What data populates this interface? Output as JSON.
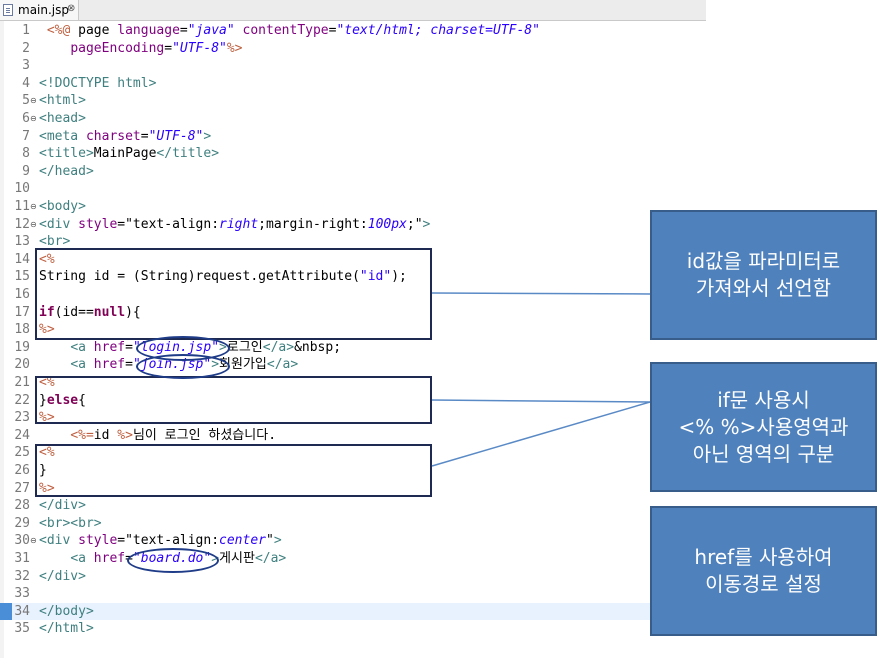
{
  "tab": {
    "label": "main.jsp",
    "close_symbol": "⊗"
  },
  "current_line": 34,
  "fold_symbol": "⊖",
  "lines": [
    {
      "n": "1",
      "fold": false,
      "parts": [
        {
          "c": "j",
          "t": " <%@"
        },
        {
          "c": "",
          "t": " page "
        },
        {
          "c": "a",
          "t": "language"
        },
        {
          "c": "",
          "t": "="
        },
        {
          "c": "s",
          "t": "\"java\""
        },
        {
          "c": "",
          "t": " "
        },
        {
          "c": "a",
          "t": "contentType"
        },
        {
          "c": "",
          "t": "="
        },
        {
          "c": "s",
          "t": "\"text/html; charset=UTF-8\""
        }
      ]
    },
    {
      "n": "2",
      "fold": false,
      "parts": [
        {
          "c": "",
          "t": "    "
        },
        {
          "c": "a",
          "t": "pageEncoding"
        },
        {
          "c": "",
          "t": "="
        },
        {
          "c": "s",
          "t": "\"UTF-8\""
        },
        {
          "c": "j",
          "t": "%>"
        }
      ]
    },
    {
      "n": "3",
      "fold": false,
      "parts": []
    },
    {
      "n": "4",
      "fold": false,
      "parts": [
        {
          "c": "t",
          "t": "<!DOCTYPE html>"
        }
      ]
    },
    {
      "n": "5",
      "fold": true,
      "parts": [
        {
          "c": "t",
          "t": "<html>"
        }
      ]
    },
    {
      "n": "6",
      "fold": true,
      "parts": [
        {
          "c": "t",
          "t": "<head>"
        }
      ]
    },
    {
      "n": "7",
      "fold": false,
      "parts": [
        {
          "c": "t",
          "t": "<meta "
        },
        {
          "c": "a",
          "t": "charset"
        },
        {
          "c": "",
          "t": "="
        },
        {
          "c": "s",
          "t": "\"UTF-8\""
        },
        {
          "c": "t",
          "t": ">"
        }
      ]
    },
    {
      "n": "8",
      "fold": false,
      "parts": [
        {
          "c": "t",
          "t": "<title>"
        },
        {
          "c": "",
          "t": "MainPage"
        },
        {
          "c": "t",
          "t": "</title>"
        }
      ]
    },
    {
      "n": "9",
      "fold": false,
      "parts": [
        {
          "c": "t",
          "t": "</head>"
        }
      ]
    },
    {
      "n": "10",
      "fold": false,
      "parts": []
    },
    {
      "n": "11",
      "fold": true,
      "parts": [
        {
          "c": "t",
          "t": "<body>"
        }
      ]
    },
    {
      "n": "12",
      "fold": true,
      "parts": [
        {
          "c": "t",
          "t": "<div "
        },
        {
          "c": "a",
          "t": "style"
        },
        {
          "c": "",
          "t": "=\"text-align:"
        },
        {
          "c": "s",
          "t": "right"
        },
        {
          "c": "",
          "t": ";margin-right:"
        },
        {
          "c": "s",
          "t": "100px"
        },
        {
          "c": "",
          "t": ";\""
        },
        {
          "c": "t",
          "t": ">"
        }
      ]
    },
    {
      "n": "13",
      "fold": false,
      "parts": [
        {
          "c": "t",
          "t": "<br>"
        }
      ]
    },
    {
      "n": "14",
      "fold": false,
      "parts": [
        {
          "c": "j",
          "t": "<%"
        }
      ]
    },
    {
      "n": "15",
      "fold": false,
      "parts": [
        {
          "c": "",
          "t": "String id = (String)request.getAttribute("
        },
        {
          "c": "sp",
          "t": "\"id\""
        },
        {
          "c": "",
          "t": ");"
        }
      ]
    },
    {
      "n": "16",
      "fold": false,
      "parts": []
    },
    {
      "n": "17",
      "fold": false,
      "parts": [
        {
          "c": "k",
          "t": "if"
        },
        {
          "c": "",
          "t": "(id=="
        },
        {
          "c": "k",
          "t": "null"
        },
        {
          "c": "",
          "t": "){"
        }
      ]
    },
    {
      "n": "18",
      "fold": false,
      "parts": [
        {
          "c": "j",
          "t": "%>"
        }
      ]
    },
    {
      "n": "19",
      "fold": false,
      "parts": [
        {
          "c": "",
          "t": "    "
        },
        {
          "c": "t",
          "t": "<a "
        },
        {
          "c": "a",
          "t": "href"
        },
        {
          "c": "",
          "t": "="
        },
        {
          "c": "s",
          "t": "\"login.jsp\""
        },
        {
          "c": "t",
          "t": ">"
        },
        {
          "c": "",
          "t": "로그인"
        },
        {
          "c": "t",
          "t": "</a>"
        },
        {
          "c": "",
          "t": "&nbsp;"
        }
      ]
    },
    {
      "n": "20",
      "fold": false,
      "parts": [
        {
          "c": "",
          "t": "    "
        },
        {
          "c": "t",
          "t": "<a "
        },
        {
          "c": "a",
          "t": "href"
        },
        {
          "c": "",
          "t": "="
        },
        {
          "c": "s",
          "t": "\"join.jsp\""
        },
        {
          "c": "t",
          "t": ">"
        },
        {
          "c": "",
          "t": "회원가입"
        },
        {
          "c": "t",
          "t": "</a>"
        }
      ]
    },
    {
      "n": "21",
      "fold": false,
      "parts": [
        {
          "c": "j",
          "t": "<%"
        }
      ]
    },
    {
      "n": "22",
      "fold": false,
      "parts": [
        {
          "c": "",
          "t": "}"
        },
        {
          "c": "k",
          "t": "else"
        },
        {
          "c": "",
          "t": "{"
        }
      ]
    },
    {
      "n": "23",
      "fold": false,
      "parts": [
        {
          "c": "j",
          "t": "%>"
        }
      ]
    },
    {
      "n": "24",
      "fold": false,
      "parts": [
        {
          "c": "",
          "t": "    "
        },
        {
          "c": "j",
          "t": "<%="
        },
        {
          "c": "",
          "t": "id "
        },
        {
          "c": "j",
          "t": "%>"
        },
        {
          "c": "",
          "t": "님이 로그인 하셨습니다."
        }
      ]
    },
    {
      "n": "25",
      "fold": false,
      "parts": [
        {
          "c": "j",
          "t": "<%"
        }
      ]
    },
    {
      "n": "26",
      "fold": false,
      "parts": [
        {
          "c": "",
          "t": "}"
        }
      ]
    },
    {
      "n": "27",
      "fold": false,
      "parts": [
        {
          "c": "j",
          "t": "%>"
        }
      ]
    },
    {
      "n": "28",
      "fold": false,
      "parts": [
        {
          "c": "t",
          "t": "</div>"
        }
      ]
    },
    {
      "n": "29",
      "fold": false,
      "parts": [
        {
          "c": "t",
          "t": "<br><br>"
        }
      ]
    },
    {
      "n": "30",
      "fold": true,
      "parts": [
        {
          "c": "t",
          "t": "<div "
        },
        {
          "c": "a",
          "t": "style"
        },
        {
          "c": "",
          "t": "=\"text-align:"
        },
        {
          "c": "s",
          "t": "center"
        },
        {
          "c": "",
          "t": "\""
        },
        {
          "c": "t",
          "t": ">"
        }
      ]
    },
    {
      "n": "31",
      "fold": false,
      "parts": [
        {
          "c": "",
          "t": "    "
        },
        {
          "c": "t",
          "t": "<a "
        },
        {
          "c": "a",
          "t": "href"
        },
        {
          "c": "",
          "t": "="
        },
        {
          "c": "s",
          "t": "\"board.do\""
        },
        {
          "c": "t",
          "t": ">"
        },
        {
          "c": "",
          "t": "게시판"
        },
        {
          "c": "t",
          "t": "</a>"
        }
      ]
    },
    {
      "n": "32",
      "fold": false,
      "parts": [
        {
          "c": "t",
          "t": "</div>"
        }
      ]
    },
    {
      "n": "33",
      "fold": false,
      "parts": []
    },
    {
      "n": "34",
      "fold": false,
      "parts": [
        {
          "c": "t",
          "t": "</body>"
        }
      ]
    },
    {
      "n": "35",
      "fold": false,
      "parts": [
        {
          "c": "t",
          "t": "</html>"
        }
      ]
    }
  ],
  "callouts": {
    "param": [
      "id값을 파라미터로",
      "가져와서 선언함"
    ],
    "ifblock": [
      "if문 사용시",
      "<% %>사용영역과",
      "아닌 영역의 구분"
    ],
    "href": [
      "href를 사용하여",
      "이동경로 설정"
    ]
  },
  "colors": {
    "callout_fill": "#4f81bd",
    "callout_border": "#385d8a",
    "annotation_line": "#1f2a52",
    "current_line_bg": "#e8f2fe",
    "tag": "#3f7f7f",
    "attribute": "#7f007f",
    "string": "#2a00ff",
    "keyword": "#7f0055",
    "jsp_delimiter": "#bf5f3f"
  }
}
